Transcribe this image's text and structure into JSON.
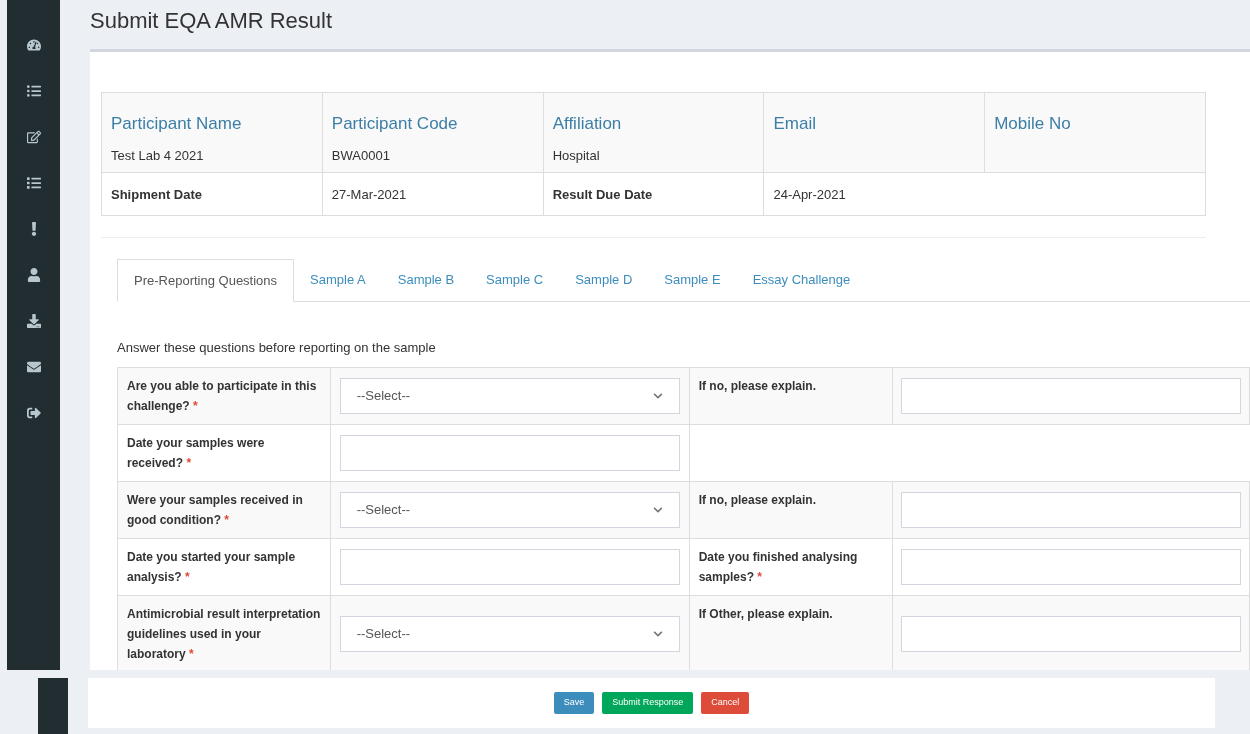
{
  "page_title": "Submit EQA AMR Result",
  "participant": {
    "headers": [
      {
        "label": "Participant Name",
        "value": "Test Lab 4 2021"
      },
      {
        "label": "Participant Code",
        "value": "BWA0001"
      },
      {
        "label": "Affiliation",
        "value": "Hospital"
      },
      {
        "label": "Email"
      },
      {
        "label": "Mobile No"
      }
    ],
    "dates": [
      "Shipment Date",
      "27-Mar-2021",
      "Result Due Date",
      "24-Apr-2021"
    ]
  },
  "tabs": [
    {
      "label": "Pre-Reporting Questions",
      "selected": true
    },
    {
      "label": "Sample A",
      "selected": false
    },
    {
      "label": "Sample B",
      "selected": false
    },
    {
      "label": "Sample C",
      "selected": false
    },
    {
      "label": "Sample D",
      "selected": false
    },
    {
      "label": "Sample E",
      "selected": false
    },
    {
      "label": "Essay Challenge",
      "selected": false
    }
  ],
  "instructions": "Answer these questions before reporting on the sample",
  "questions": [
    {
      "label": "Are you able to participate in this challenge?",
      "required_mark": "*",
      "input": {
        "kind": "select",
        "placeholder": "--Select--"
      },
      "followup": {
        "label": "If no, please explain.",
        "input": {
          "kind": "text"
        }
      }
    },
    {
      "label": "Date your samples were received?",
      "required_mark": "*",
      "input": {
        "kind": "text"
      }
    },
    {
      "label": "Were your samples received in good condition?",
      "required_mark": "*",
      "input": {
        "kind": "select",
        "placeholder": "--Select--"
      },
      "followup": {
        "label": "If no, please explain.",
        "input": {
          "kind": "text"
        }
      }
    },
    {
      "label": "Date you started your sample analysis?",
      "required_mark": "*",
      "input": {
        "kind": "text"
      },
      "followup": {
        "label": "Date you finished analysing samples?",
        "required_mark": "*",
        "input": {
          "kind": "text"
        }
      }
    },
    {
      "label": "Antimicrobial result interpretation guidelines used in your laboratory",
      "required_mark": "*",
      "input": {
        "kind": "select",
        "placeholder": "--Select--"
      },
      "followup": {
        "label": "If Other, please explain.",
        "input": {
          "kind": "text"
        }
      }
    }
  ],
  "buttons": [
    {
      "label": "Save",
      "kind": "primary"
    },
    {
      "label": "Submit Response",
      "kind": "success"
    },
    {
      "label": "Cancel",
      "kind": "danger"
    }
  ]
}
